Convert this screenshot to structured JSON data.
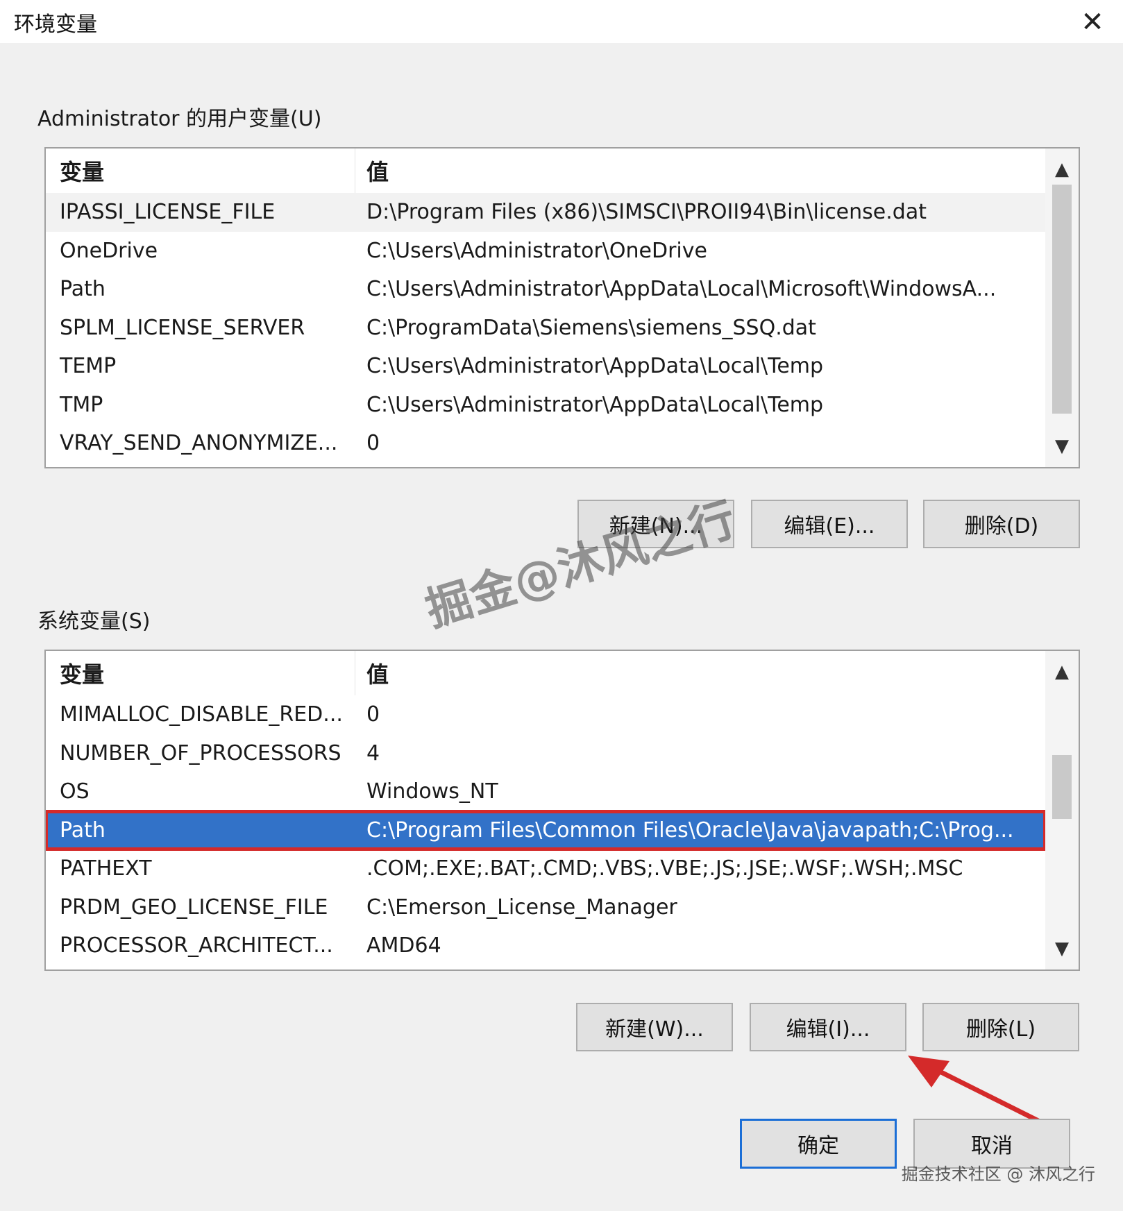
{
  "window": {
    "title": "环境变量",
    "close_glyph": "✕"
  },
  "user_vars": {
    "label": "Administrator 的用户变量(U)",
    "columns": {
      "variable": "变量",
      "value": "值"
    },
    "rows": [
      {
        "name": "IPASSI_LICENSE_FILE",
        "value": "D:\\Program Files (x86)\\SIMSCI\\PROII94\\Bin\\license.dat"
      },
      {
        "name": "OneDrive",
        "value": "C:\\Users\\Administrator\\OneDrive"
      },
      {
        "name": "Path",
        "value": "C:\\Users\\Administrator\\AppData\\Local\\Microsoft\\WindowsA..."
      },
      {
        "name": "SPLM_LICENSE_SERVER",
        "value": "C:\\ProgramData\\Siemens\\siemens_SSQ.dat"
      },
      {
        "name": "TEMP",
        "value": "C:\\Users\\Administrator\\AppData\\Local\\Temp"
      },
      {
        "name": "TMP",
        "value": "C:\\Users\\Administrator\\AppData\\Local\\Temp"
      },
      {
        "name": "VRAY_SEND_ANONYMIZE...",
        "value": "0"
      }
    ],
    "buttons": {
      "new": "新建(N)...",
      "edit": "编辑(E)...",
      "delete": "删除(D)"
    }
  },
  "system_vars": {
    "label": "系统变量(S)",
    "columns": {
      "variable": "变量",
      "value": "值"
    },
    "rows": [
      {
        "name": "MIMALLOC_DISABLE_RED...",
        "value": "0"
      },
      {
        "name": "NUMBER_OF_PROCESSORS",
        "value": "4"
      },
      {
        "name": "OS",
        "value": "Windows_NT"
      },
      {
        "name": "Path",
        "value": "C:\\Program Files\\Common Files\\Oracle\\Java\\javapath;C:\\Prog..."
      },
      {
        "name": "PATHEXT",
        "value": ".COM;.EXE;.BAT;.CMD;.VBS;.VBE;.JS;.JSE;.WSF;.WSH;.MSC"
      },
      {
        "name": "PRDM_GEO_LICENSE_FILE",
        "value": "C:\\Emerson_License_Manager"
      },
      {
        "name": "PROCESSOR_ARCHITECT...",
        "value": "AMD64"
      }
    ],
    "selected_row": "Path",
    "buttons": {
      "new": "新建(W)...",
      "edit": "编辑(I)...",
      "delete": "删除(L)"
    }
  },
  "footer": {
    "ok": "确定",
    "cancel": "取消"
  },
  "watermark": {
    "center": "掘金@沐风之行",
    "corner": "掘金技术社区 @ 沐风之行"
  },
  "colors": {
    "selection": "#3272c8",
    "highlight_border": "#d42a2a",
    "arrow": "#d42a2a"
  },
  "icons": {
    "scroll_up": "chevron-up-icon",
    "scroll_down": "chevron-down-icon",
    "close": "close-icon"
  }
}
